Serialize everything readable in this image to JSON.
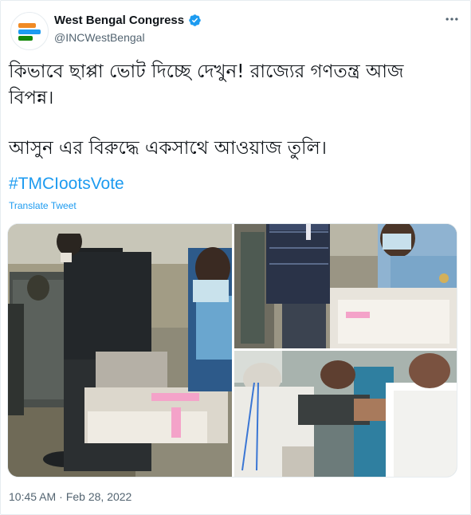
{
  "account": {
    "display_name": "West Bengal Congress",
    "handle": "@INCWestBengal",
    "verified": true,
    "avatar_colors": [
      "#f08a24",
      "#1d9bf0",
      "#138808"
    ]
  },
  "tweet": {
    "lines": [
      "কিভাবে ছাপ্পা ভোট দিচ্ছে দেখুন! রাজ্যের গণতন্ত্র আজ",
      "বিপন্ন।",
      "আসুন এর বিরুদ্ধে একসাথে আওয়াজ তুলি।"
    ],
    "hashtag": "#TMCIootsVote",
    "translate_label": "Translate Tweet"
  },
  "media": {
    "photo_count": 3,
    "photos": [
      {
        "icon": "photo-voting-booth"
      },
      {
        "icon": "photo-polling-officer"
      },
      {
        "icon": "photo-scuffle"
      }
    ]
  },
  "footer": {
    "time": "10:45 AM",
    "separator": "·",
    "date": "Feb 28, 2022"
  },
  "colors": {
    "accent": "#1d9bf0",
    "text": "#0f1419",
    "muted": "#536471"
  }
}
